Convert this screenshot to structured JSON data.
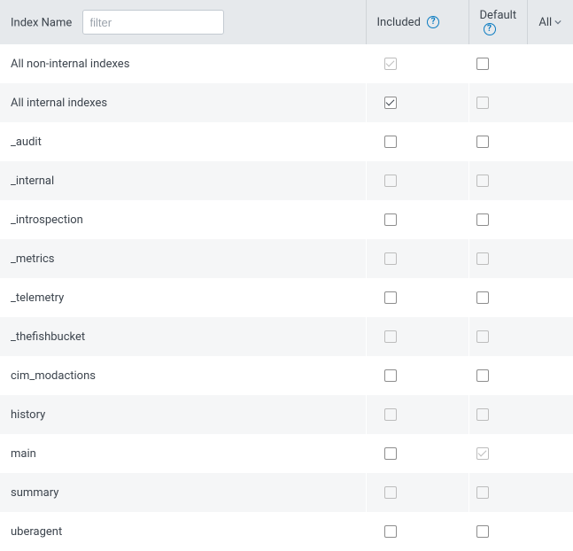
{
  "header": {
    "index_name_label": "Index Name",
    "filter_placeholder": "filter",
    "included_label": "Included",
    "default_label": "Default",
    "all_label": "All"
  },
  "rows": [
    {
      "name": "All non-internal indexes",
      "included_checked": true,
      "included_disabled": true,
      "default_checked": false,
      "default_disabled": false,
      "alt": false
    },
    {
      "name": "All internal indexes",
      "included_checked": true,
      "included_disabled": false,
      "default_checked": false,
      "default_disabled": true,
      "alt": true
    },
    {
      "name": "_audit",
      "included_checked": false,
      "included_disabled": false,
      "default_checked": false,
      "default_disabled": false,
      "alt": false
    },
    {
      "name": "_internal",
      "included_checked": false,
      "included_disabled": true,
      "default_checked": false,
      "default_disabled": true,
      "alt": true
    },
    {
      "name": "_introspection",
      "included_checked": false,
      "included_disabled": false,
      "default_checked": false,
      "default_disabled": false,
      "alt": false
    },
    {
      "name": "_metrics",
      "included_checked": false,
      "included_disabled": true,
      "default_checked": false,
      "default_disabled": true,
      "alt": true
    },
    {
      "name": "_telemetry",
      "included_checked": false,
      "included_disabled": false,
      "default_checked": false,
      "default_disabled": false,
      "alt": false
    },
    {
      "name": "_thefishbucket",
      "included_checked": false,
      "included_disabled": true,
      "default_checked": false,
      "default_disabled": true,
      "alt": true
    },
    {
      "name": "cim_modactions",
      "included_checked": false,
      "included_disabled": false,
      "default_checked": false,
      "default_disabled": false,
      "alt": false
    },
    {
      "name": "history",
      "included_checked": false,
      "included_disabled": true,
      "default_checked": false,
      "default_disabled": true,
      "alt": true
    },
    {
      "name": "main",
      "included_checked": false,
      "included_disabled": false,
      "default_checked": true,
      "default_disabled": true,
      "alt": false
    },
    {
      "name": "summary",
      "included_checked": false,
      "included_disabled": true,
      "default_checked": false,
      "default_disabled": true,
      "alt": true
    },
    {
      "name": "uberagent",
      "included_checked": false,
      "included_disabled": false,
      "default_checked": false,
      "default_disabled": false,
      "alt": false
    }
  ]
}
